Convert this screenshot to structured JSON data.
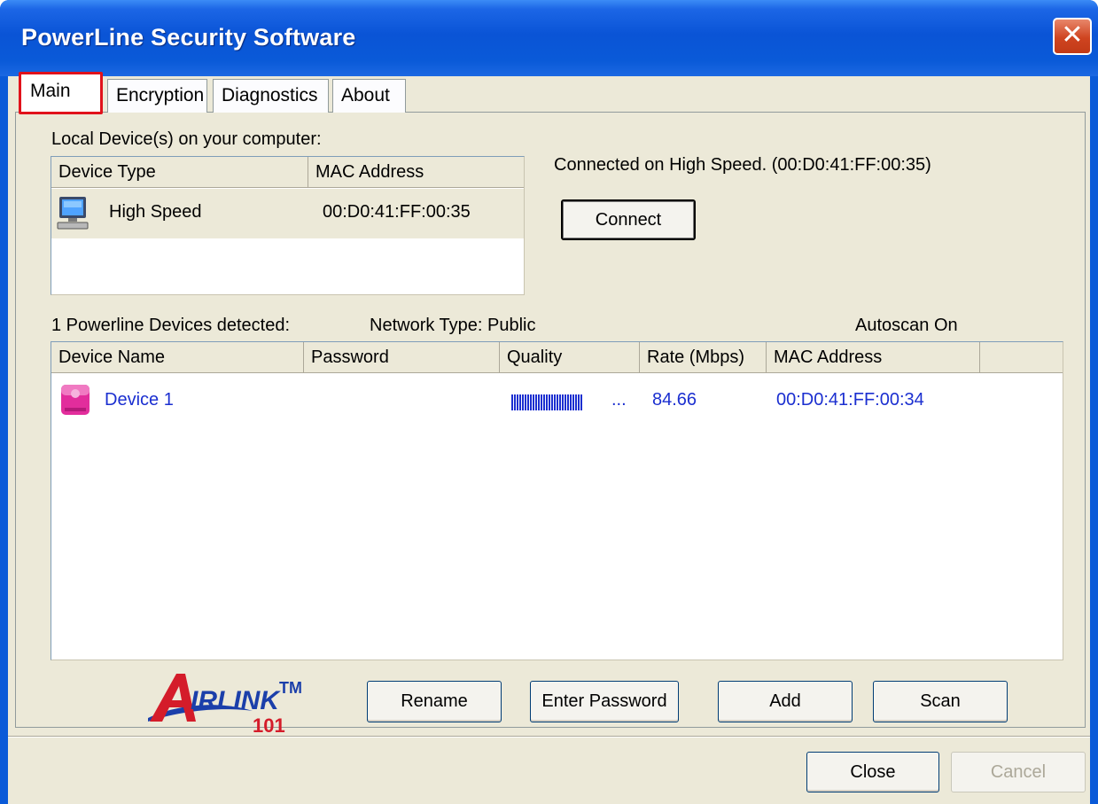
{
  "window": {
    "title": "PowerLine Security Software"
  },
  "tabs": [
    "Main",
    "Encryption",
    "Diagnostics",
    "About"
  ],
  "local": {
    "section_label": "Local Device(s) on your computer:",
    "columns": [
      "Device Type",
      "MAC Address"
    ],
    "rows": [
      {
        "icon": "computer-icon",
        "type": "High Speed",
        "mac": "00:D0:41:FF:00:35"
      }
    ],
    "status": "Connected on  High Speed. (00:D0:41:FF:00:35)",
    "connect_label": "Connect"
  },
  "powerline": {
    "detected_label": "1 Powerline Devices detected:",
    "network_type": "Network Type: Public",
    "autoscan": "Autoscan On",
    "columns": [
      "Device Name",
      "Password",
      "Quality",
      "Rate (Mbps)",
      "MAC Address"
    ],
    "rows": [
      {
        "icon": "powerline-adapter-icon",
        "name": "Device 1",
        "password": "",
        "quality": 0.75,
        "rate": "84.66",
        "mac": "00:D0:41:FF:00:34"
      }
    ]
  },
  "actions": {
    "rename": "Rename",
    "enter_password": "Enter Password",
    "add": "Add",
    "scan": "Scan"
  },
  "footer": {
    "close": "Close",
    "cancel": "Cancel"
  },
  "logo": {
    "text": "AirLink",
    "tm": "TM",
    "number": "101"
  },
  "colors": {
    "device_text": "#1b2fd0",
    "highlight": "#e1121b"
  }
}
